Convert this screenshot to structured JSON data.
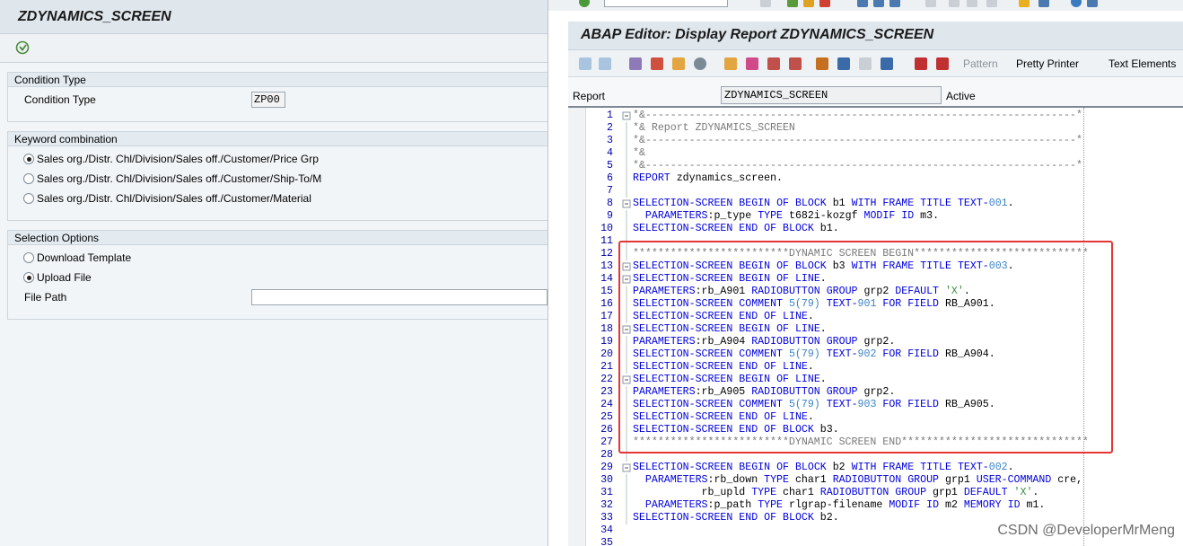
{
  "left": {
    "title": "ZDYNAMICS_SCREEN",
    "group_condition": {
      "header": "Condition Type",
      "label": "Condition Type",
      "value": "ZP00"
    },
    "group_keyword": {
      "header": "Keyword combination",
      "options": [
        {
          "label": "Sales org./Distr. Chl/Division/Sales off./Customer/Price Grp",
          "selected": true
        },
        {
          "label": "Sales org./Distr. Chl/Division/Sales off./Customer/Ship-To/M",
          "selected": false
        },
        {
          "label": "Sales org./Distr. Chl/Division/Sales off./Customer/Material",
          "selected": false
        }
      ]
    },
    "group_selection": {
      "header": "Selection Options",
      "download_label": "Download Template",
      "upload_label": "Upload File",
      "file_path_label": "File Path",
      "file_path_value": ""
    }
  },
  "editor": {
    "title": "ABAP Editor: Display Report ZDYNAMICS_SCREEN",
    "toolbar": {
      "pattern": "Pattern",
      "pretty_printer": "Pretty Printer",
      "text_elements": "Text Elements"
    },
    "report_label": "Report",
    "report_value": "ZDYNAMICS_SCREEN",
    "status": "Active",
    "code": [
      "*&---------------------------------------------------------------------*",
      "*& Report ZDYNAMICS_SCREEN",
      "*&---------------------------------------------------------------------*",
      "*&",
      "*&---------------------------------------------------------------------*",
      "REPORT zdynamics_screen.",
      "",
      "SELECTION-SCREEN BEGIN OF BLOCK b1 WITH FRAME TITLE TEXT-001.",
      "  PARAMETERS:p_type TYPE t682i-kozgf MODIF ID m3.",
      "SELECTION-SCREEN END OF BLOCK b1.",
      "",
      "*************************DYNAMIC SCREEN BEGIN****************************",
      "SELECTION-SCREEN BEGIN OF BLOCK b3 WITH FRAME TITLE TEXT-003.",
      "SELECTION-SCREEN BEGIN OF LINE.",
      "PARAMETERS:rb_A901 RADIOBUTTON GROUP grp2 DEFAULT 'X'.",
      "SELECTION-SCREEN COMMENT 5(79) TEXT-901 FOR FIELD RB_A901.",
      "SELECTION-SCREEN END OF LINE.",
      "SELECTION-SCREEN BEGIN OF LINE.",
      "PARAMETERS:rb_A904 RADIOBUTTON GROUP grp2.",
      "SELECTION-SCREEN COMMENT 5(79) TEXT-902 FOR FIELD RB_A904.",
      "SELECTION-SCREEN END OF LINE.",
      "SELECTION-SCREEN BEGIN OF LINE.",
      "PARAMETERS:rb_A905 RADIOBUTTON GROUP grp2.",
      "SELECTION-SCREEN COMMENT 5(79) TEXT-903 FOR FIELD RB_A905.",
      "SELECTION-SCREEN END OF LINE.",
      "SELECTION-SCREEN END OF BLOCK b3.",
      "*************************DYNAMIC SCREEN END******************************",
      "",
      "SELECTION-SCREEN BEGIN OF BLOCK b2 WITH FRAME TITLE TEXT-002.",
      "  PARAMETERS:rb_down TYPE char1 RADIOBUTTON GROUP grp1 USER-COMMAND cre,",
      "           rb_upld TYPE char1 RADIOBUTTON GROUP grp1 DEFAULT 'X'.",
      "  PARAMETERS:p_path TYPE rlgrap-filename MODIF ID m2 MEMORY ID m1.",
      "SELECTION-SCREEN END OF BLOCK b2.",
      "",
      ""
    ]
  },
  "watermark": "CSDN @DeveloperMrMeng",
  "colors": {
    "keyword": "#0000dd",
    "comment": "#7a7a7a",
    "string": "#3a8f3a",
    "number": "#3b83c4",
    "highlight_box": "#e53535"
  }
}
